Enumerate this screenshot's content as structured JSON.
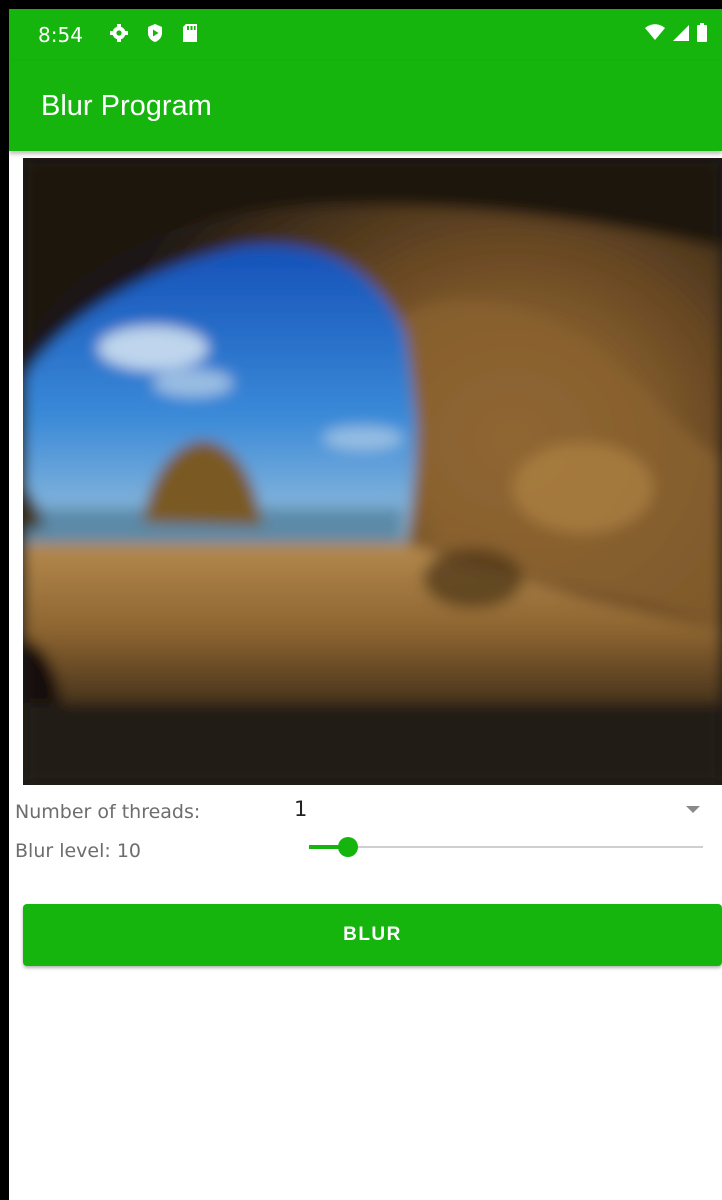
{
  "status_bar": {
    "time": "8:54",
    "left_icons": [
      "settings-icon",
      "shield-play-icon",
      "sd-card-icon"
    ],
    "right_icons": [
      "wifi-icon",
      "signal-icon",
      "battery-icon"
    ]
  },
  "app_bar": {
    "title": "Blur Program"
  },
  "photo": {
    "description_icon": "blurred-cave-beach-photo"
  },
  "controls": {
    "threads_label": "Number of threads:",
    "threads_value": "1",
    "blur_label": "Blur level: 10",
    "blur_slider_fraction": 0.1
  },
  "button": {
    "blur_label": "BLUR"
  },
  "colors": {
    "accent": "#15b50e",
    "label_text": "#6d6d6d"
  }
}
